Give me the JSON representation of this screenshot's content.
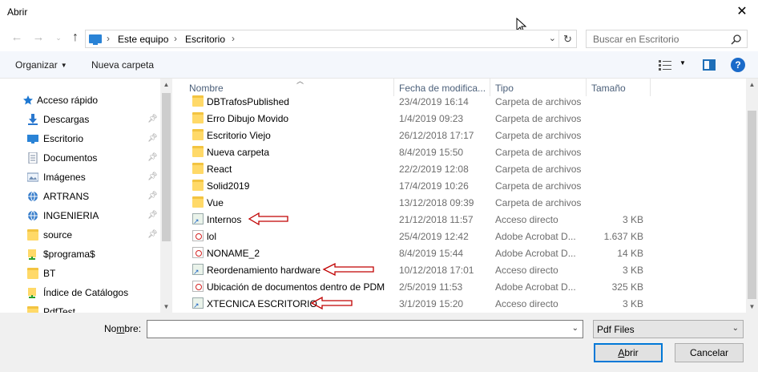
{
  "window": {
    "title": "Abrir",
    "close_icon": "close-icon"
  },
  "navigation": {
    "back_icon": "back-arrow-icon",
    "forward_icon": "forward-arrow-icon",
    "recent_icon": "chevron-down-icon",
    "up_icon": "up-arrow-icon",
    "breadcrumb": [
      "Este equipo",
      "Escritorio"
    ],
    "separator": "›",
    "refresh_icon": "refresh-icon",
    "search_placeholder": "Buscar en Escritorio"
  },
  "toolbar": {
    "organize_label": "Organizar",
    "new_folder_label": "Nueva carpeta",
    "view_icon": "view-details-icon",
    "preview_icon": "preview-pane-icon",
    "help_label": "?"
  },
  "sidebar": {
    "items": [
      {
        "label": "Acceso rápido",
        "icon": "star-icon",
        "pinned": false
      },
      {
        "label": "Descargas",
        "icon": "download-icon",
        "pinned": true
      },
      {
        "label": "Escritorio",
        "icon": "desktop-icon",
        "pinned": true
      },
      {
        "label": "Documentos",
        "icon": "document-icon",
        "pinned": true
      },
      {
        "label": "Imágenes",
        "icon": "pictures-icon",
        "pinned": true
      },
      {
        "label": "ARTRANS",
        "icon": "network-drive-icon",
        "pinned": true
      },
      {
        "label": "INGENIERIA",
        "icon": "network-drive-icon",
        "pinned": true
      },
      {
        "label": "source",
        "icon": "folder-icon",
        "pinned": true
      },
      {
        "label": "$programa$",
        "icon": "shared-folder-icon",
        "pinned": false
      },
      {
        "label": "BT",
        "icon": "folder-icon",
        "pinned": false
      },
      {
        "label": "Índice de Catálogos",
        "icon": "shared-folder-icon",
        "pinned": false
      },
      {
        "label": "PdfTest",
        "icon": "folder-icon",
        "pinned": false
      }
    ]
  },
  "columns": {
    "name": "Nombre",
    "date": "Fecha de modifica...",
    "type": "Tipo",
    "size": "Tamaño"
  },
  "files": [
    {
      "name": "DBTrafosPublished",
      "date": "23/4/2019 16:14",
      "type": "Carpeta de archivos",
      "size": "",
      "kind": "folder",
      "annotated": false
    },
    {
      "name": "Erro Dibujo Movido",
      "date": "1/4/2019 09:23",
      "type": "Carpeta de archivos",
      "size": "",
      "kind": "folder",
      "annotated": false
    },
    {
      "name": "Escritorio Viejo",
      "date": "26/12/2018 17:17",
      "type": "Carpeta de archivos",
      "size": "",
      "kind": "folder",
      "annotated": false
    },
    {
      "name": "Nueva carpeta",
      "date": "8/4/2019 15:50",
      "type": "Carpeta de archivos",
      "size": "",
      "kind": "folder",
      "annotated": false
    },
    {
      "name": "React",
      "date": "22/2/2019 12:08",
      "type": "Carpeta de archivos",
      "size": "",
      "kind": "folder",
      "annotated": false
    },
    {
      "name": "Solid2019",
      "date": "17/4/2019 10:26",
      "type": "Carpeta de archivos",
      "size": "",
      "kind": "folder",
      "annotated": false
    },
    {
      "name": "Vue",
      "date": "13/12/2018 09:39",
      "type": "Carpeta de archivos",
      "size": "",
      "kind": "folder",
      "annotated": false
    },
    {
      "name": "Internos",
      "date": "21/12/2018 11:57",
      "type": "Acceso directo",
      "size": "3 KB",
      "kind": "shortcut",
      "annotated": true
    },
    {
      "name": "lol",
      "date": "25/4/2019 12:42",
      "type": "Adobe Acrobat D...",
      "size": "1.637 KB",
      "kind": "pdf",
      "annotated": false
    },
    {
      "name": "NONAME_2",
      "date": "8/4/2019 15:44",
      "type": "Adobe Acrobat D...",
      "size": "14 KB",
      "kind": "pdf",
      "annotated": false
    },
    {
      "name": "Reordenamiento hardware",
      "date": "10/12/2018 17:01",
      "type": "Acceso directo",
      "size": "3 KB",
      "kind": "shortcut",
      "annotated": true
    },
    {
      "name": "Ubicación de documentos dentro de PDM",
      "date": "2/5/2019 11:53",
      "type": "Adobe Acrobat D...",
      "size": "325 KB",
      "kind": "pdf",
      "annotated": false
    },
    {
      "name": "XTECNICA ESCRITORIO",
      "date": "3/1/2019 15:20",
      "type": "Acceso directo",
      "size": "3 KB",
      "kind": "shortcut",
      "annotated": true
    }
  ],
  "footer": {
    "filename_label": "Nombre:",
    "filename_value": "",
    "filetype_value": "Pdf Files",
    "open_label": "Abrir",
    "cancel_label": "Cancelar"
  },
  "colors": {
    "accent": "#0078d7",
    "annotation_arrow": "#c00000",
    "folder": "#ffd968",
    "pdf": "#d42424"
  }
}
